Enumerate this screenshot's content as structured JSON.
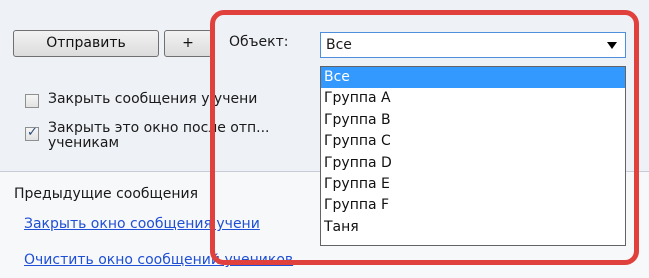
{
  "toolbar": {
    "send_label": "Отправить",
    "plus_label": "+",
    "object_label": "Объект:"
  },
  "object_select": {
    "selected": "Все",
    "options": [
      "Все",
      "Группа A",
      "Группа B",
      "Группа C",
      "Группа D",
      "Группа E",
      "Группа F",
      "Таня"
    ]
  },
  "options": {
    "close_messages_label": "Закрыть сообщения у учени",
    "close_messages_checked": false,
    "close_window_label": "Закрыть это окно после отп... ученикам",
    "close_window_checked": true
  },
  "previous": {
    "title": "Предыдущие сообщения",
    "links": [
      "Закрыть окно сообщения учени",
      "Очистить окно сообщений учеников"
    ]
  },
  "colors": {
    "highlight": "#e0413d",
    "selected_item": "#3399ff",
    "link": "#1f4fd4"
  }
}
